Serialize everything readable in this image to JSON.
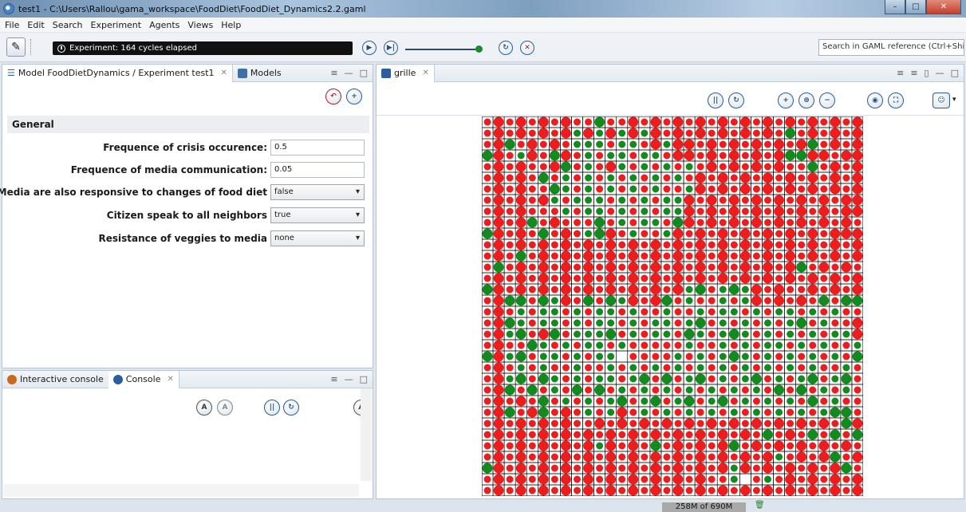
{
  "window": {
    "title": "test1 - C:\\Users\\Rallou\\gama_workspace\\FoodDiet\\FoodDiet_Dynamics2.2.gaml"
  },
  "menu": [
    "File",
    "Edit",
    "Search",
    "Experiment",
    "Agents",
    "Views",
    "Help"
  ],
  "toolbar": {
    "status": "Experiment: 164 cycles elapsed",
    "search_placeholder": "Search in GAML reference (Ctrl+Shift+"
  },
  "params_panel": {
    "tab1": "Model FoodDietDynamics / Experiment test1",
    "tab2": "Models",
    "section": "General",
    "params": [
      {
        "label": "Frequence of crisis occurence:",
        "value": "0.5",
        "kind": "text"
      },
      {
        "label": "Frequence of media communication:",
        "value": "0.05",
        "kind": "text"
      },
      {
        "label": "Media are also responsive to changes of food diet",
        "value": "false",
        "kind": "select"
      },
      {
        "label": "Citizen speak to all neighbors",
        "value": "true",
        "kind": "select"
      },
      {
        "label": "Resistance of veggies to media",
        "value": "none",
        "kind": "select"
      }
    ]
  },
  "console_panel": {
    "tab1": "Interactive console",
    "tab2": "Console"
  },
  "view_panel": {
    "tab": "grille"
  },
  "memory": "258M of 690M",
  "colors": {
    "red": "#ee1c1c",
    "green": "#138a1e",
    "grid_bg": "#ffffff"
  },
  "grid": {
    "cols": 34,
    "rows": 34,
    "rows_data": [
      "rRrRrRrRrrGrrRrRrRrRrRrRrRrRrRrRrR",
      "rRrRrRrRgRgRgRgRrRrRrRrRrRrGrRrRrR",
      "rRGrRrRrgggrggrRgRRrRrRrRrRrRGrRrR",
      "GRrgRrGRrgrggrggrRRrRrRrRrRGGRRrRR",
      "rRrRrrRGrgrRgrgrgrgrRrRrRrRrrGrRrR",
      "rRrRrGrgrgrgrgrgrgrRrRrRrRrRrRrRrR",
      "rRrRrrGgrgrgrgrgrrgRrRrRrRrRrRrRrR",
      "rRrRrRgrgggrgrgrggRrRrRrRrRrRrRrRR",
      "rRrRrrrgrggrgrgrggRrRrRrRrRrRrRrRR",
      "rRrRGrRrrrGrgrggrGRrRrRrRrRrRrRrRr",
      "GRrRrGrRrgGRrgrrgRrRrRrRrRrRrRrRRR",
      "rRrRrRrRrRrRrRrRrRrRrRrRrRrRrRrRrR",
      "rRrGrRrRrRrRrRrRrRrRrRrRrRrRrRrRrR",
      "rGrRrRrRrRrRrRrRrRrRrRrRrRrRGrRrRr",
      "rRrRrRrRrRrRrRrRrRrRrRrRrRrRrRrRrR",
      "GRrRrRrRrRrRrRrRrRgGrgGgRrRrrRrRrR",
      "rRGGrGgRrGrGgRrRGrgrrgrgRrRrRrGrGG",
      "rRrgrggrgrggrgrrgrrgrggrgrggrgrgrr",
      "rRGgrggrgrggrgrggrgGrgrgrgrgGrgrrR",
      "rRgGrRGrgggGrgrggrGgrgGgrgrgrgrggR",
      "rRrrGgrgrggrgrrrrrgrrgrgrggrgrgrrg",
      "GRgGrggrgrgg.rrrrgrgrgGgrgrgrgrgrG",
      "rRrgrgrrgrrgrgrgrgrgrgrgrgrgrgrrgr",
      "rRgGrGgrgrggrgGrGrgGrgrgGrgrgGrgGr",
      "rRGrGrgrGrGrgrgrgrgrgrgrgrGrGrgrgr",
      "rRrRrGrgrgrgGrgGrgGrgGrgrgrgrGrgrr",
      "rRGrRGrRrgrgRrgrgrgrgrgrgrgrgrgGGr",
      "rRrRrRrRrrRrRrRrRrRrRrRrRrRrRrRrGR",
      "rRrRrRrRrRrRrRrRrRrRrRrRrGrRrGrGrG",
      "rRrRrRrRrRgRrRrGrRrRrRGrRrRrRrRrRr",
      "rRrRrRrRrRrRrRrRrRrRrRrRrRgrRrRGrR",
      "GRrRrRrRrRrRrRrRrRrRrRgRrRrRrRrRGr",
      "rRrRrRrRrRrRrRrRrRrRrrg.rgrRrRrRrR",
      "rRrRrRrRrRrRrRrRrRrRrRrRrRrRrRrRrR"
    ]
  }
}
